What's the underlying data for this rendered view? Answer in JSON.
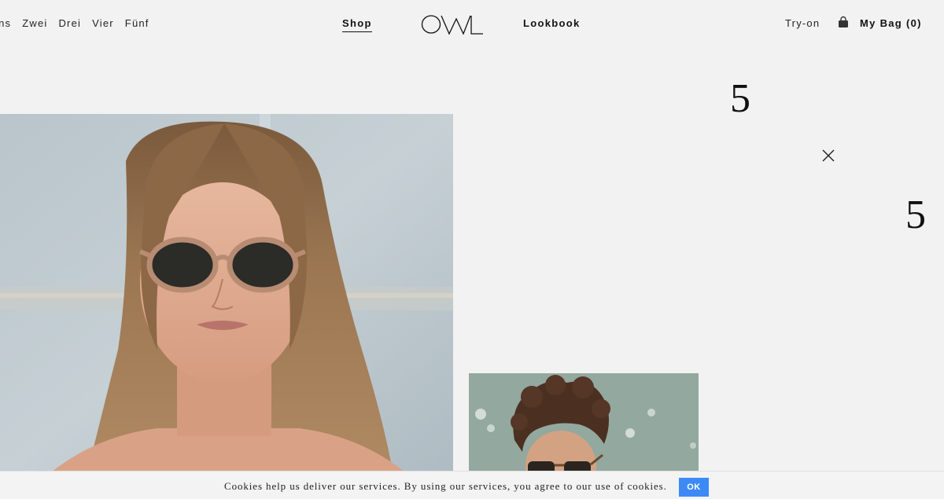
{
  "nav": {
    "left_items": [
      "ins",
      "Zwei",
      "Drei",
      "Vier",
      "Fünf"
    ],
    "shop_label": "Shop",
    "logo_text": "OWL",
    "lookbook_label": "Lookbook",
    "tryon_label": "Try-on",
    "bag_label": "My Bag (0)"
  },
  "content": {
    "numeral_1": "5",
    "numeral_2": "5"
  },
  "cookie": {
    "message": "Cookies help us deliver our services. By using our services, you agree to our use of cookies.",
    "ok_label": "OK"
  },
  "colors": {
    "background": "#f2f2f2",
    "ok_button": "#3d8af7"
  }
}
